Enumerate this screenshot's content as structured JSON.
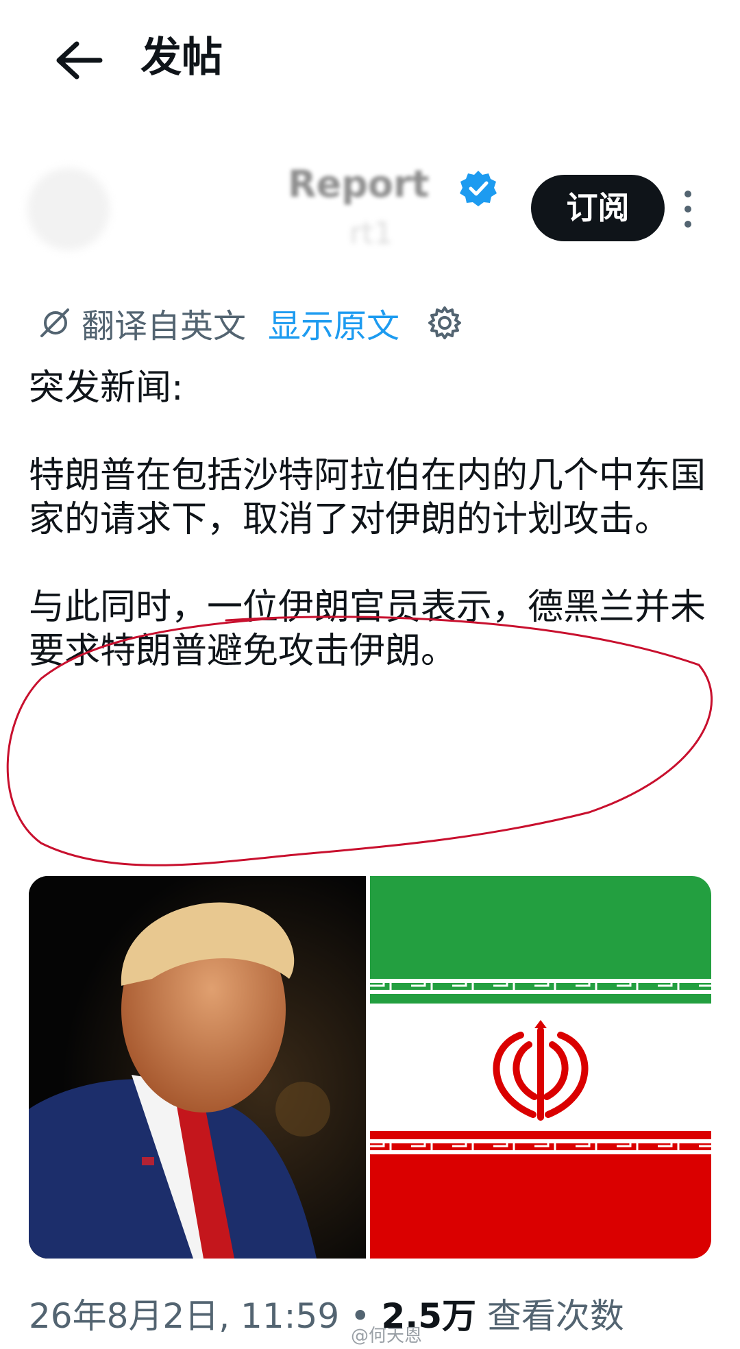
{
  "header": {
    "back_icon": "arrow-left-icon",
    "title": "发帖"
  },
  "author": {
    "name": "Report",
    "handle": "rt1",
    "verified_icon": "verified-badge-icon",
    "verified_color": "#1d9bf0"
  },
  "actions": {
    "subscribe_label": "订阅",
    "more_icon": "more-vertical-icon"
  },
  "translation": {
    "icon": "translate-icon",
    "label": "翻译自英文",
    "show_original": "显示原文",
    "settings_icon": "gear-icon",
    "link_color": "#1d9bf0"
  },
  "post": {
    "paragraphs": [
      "突发新闻:",
      "特朗普在包括沙特阿拉伯在内的几个中东国家的请求下，取消了对伊朗的计划攻击。",
      "与此同时，一位伊朗官员表示，德黑兰并未要求特朗普避免攻击伊朗。"
    ]
  },
  "annotation": {
    "color": "#c8102e"
  },
  "media": {
    "left": "photo-portrait",
    "right": "iran-flag-image"
  },
  "footer": {
    "date": "26年8月2日, 11:59",
    "separator": "•",
    "views_count": "2.5万",
    "views_label": "查看次数"
  },
  "watermark": "@何天恩"
}
